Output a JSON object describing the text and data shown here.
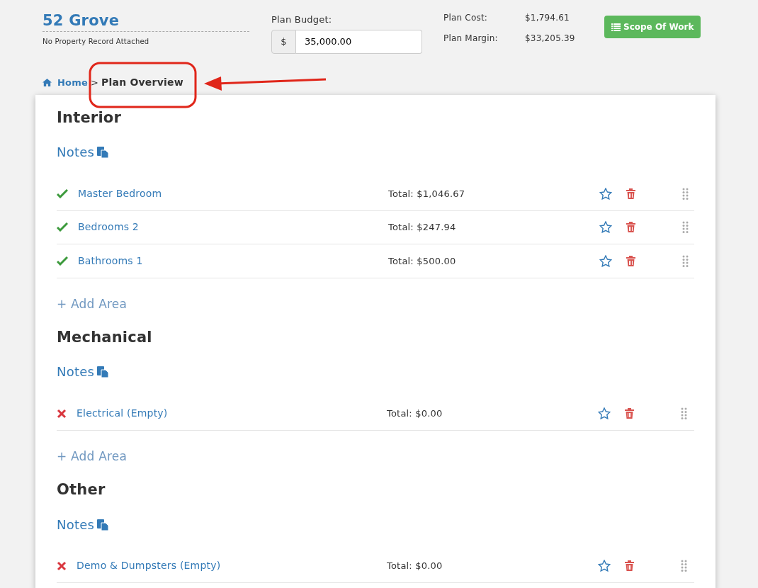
{
  "header": {
    "title": "52 Grove",
    "subtitle": "No Property Record Attached",
    "budget_label": "Plan Budget:",
    "budget_prefix": "$",
    "budget_value": "35,000.00",
    "cost_label": "Plan Cost:",
    "cost_value": "$1,794.61",
    "margin_label": "Plan Margin:",
    "margin_value": "$33,205.39",
    "scope_button": "Scope Of Work"
  },
  "breadcrumb": {
    "home": "Home",
    "separator": ">",
    "current": "Plan Overview"
  },
  "annotation": {
    "kind": "callout"
  },
  "sections": [
    {
      "title": "Interior",
      "notes": "Notes",
      "add": "+ Add Area",
      "areas": [
        {
          "name": "Master Bedroom",
          "complete": true,
          "total": "Total: $1,046.67",
          "starred": false
        },
        {
          "name": "Bedrooms 2",
          "complete": true,
          "total": "Total: $247.94",
          "starred": false
        },
        {
          "name": "Bathrooms 1",
          "complete": true,
          "total": "Total: $500.00",
          "starred": false
        }
      ]
    },
    {
      "title": "Mechanical",
      "notes": "Notes",
      "add": "+ Add Area",
      "areas": [
        {
          "name": "Electrical (Empty)",
          "complete": false,
          "total": "Total: $0.00",
          "starred": false
        }
      ]
    },
    {
      "title": "Other",
      "notes": "Notes",
      "areas": [
        {
          "name": "Demo & Dumpsters (Empty)",
          "complete": false,
          "total": "Total: $0.00",
          "starred": false
        }
      ]
    }
  ]
}
